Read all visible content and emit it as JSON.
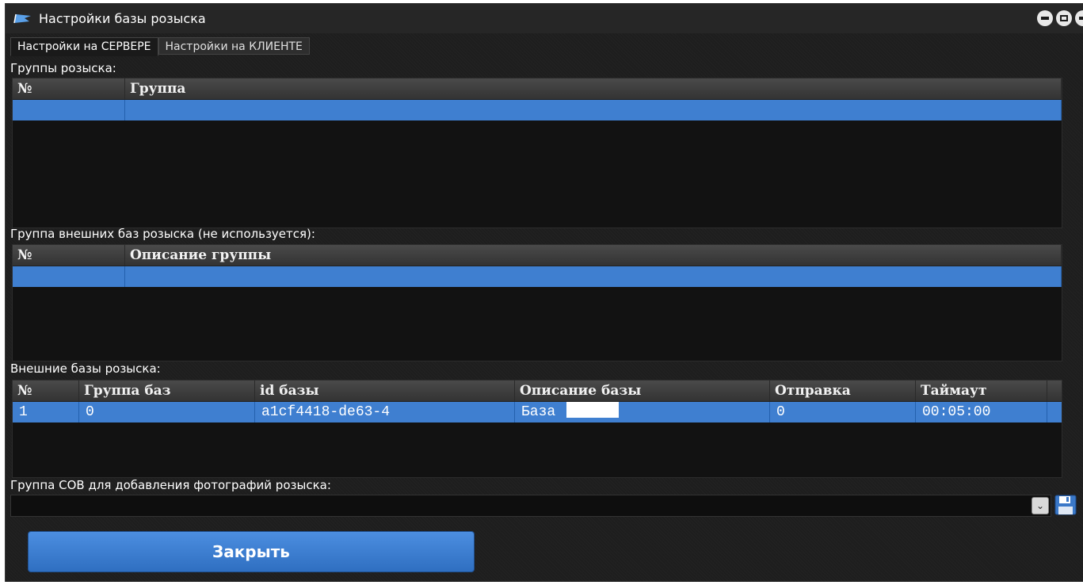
{
  "window": {
    "title": "Настройки базы розыска"
  },
  "tabs": [
    {
      "label": "Настройки на СЕРВЕРЕ",
      "active": true
    },
    {
      "label": "Настройки на КЛИЕНТЕ",
      "active": false
    }
  ],
  "groups": {
    "label": "Группы розыска:",
    "columns": [
      "№",
      "Группа"
    ],
    "rows": [
      [
        "",
        ""
      ]
    ]
  },
  "external_groups": {
    "label": "Группа внешних баз розыска (не используется):",
    "columns": [
      "№",
      "Описание группы"
    ],
    "rows": [
      [
        "",
        ""
      ]
    ]
  },
  "external_bases": {
    "label": "Внешние базы розыска:",
    "columns": [
      "№",
      "Группа баз",
      "id базы",
      "Описание базы",
      "Отправка",
      "Таймаут"
    ],
    "rows": [
      {
        "num": "1",
        "group": "0",
        "id": "a1cf4418-de63-4",
        "description": "База",
        "send": "0",
        "timeout": "00:05:00"
      }
    ]
  },
  "photo_group": {
    "label": "Группа СОВ для добавления фотографий розыска:",
    "value": ""
  },
  "buttons": {
    "close": "Закрыть"
  },
  "colors": {
    "selection": "#3f7fd0",
    "background": "#1e1e1e",
    "button": "#3a7bd0"
  }
}
